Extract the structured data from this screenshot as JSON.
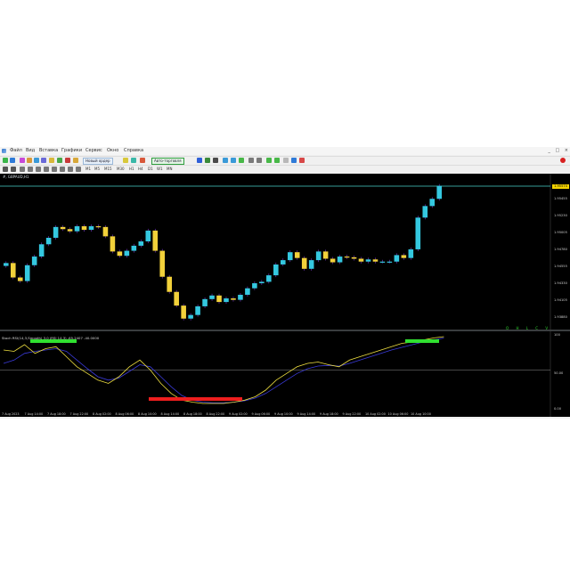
{
  "menu": {
    "items": [
      "Файл",
      "Вид",
      "Вставка",
      "Графики",
      "Сервис",
      "Окно",
      "Справка"
    ],
    "window_controls": [
      "_",
      "□",
      "×"
    ]
  },
  "toolbar": {
    "new_order_label": "Новый ордер",
    "algo_label": "Авто-торговля",
    "timeframes": [
      "M1",
      "M5",
      "M15",
      "M30",
      "H1",
      "H4",
      "D1",
      "W1",
      "MN"
    ]
  },
  "chart": {
    "title": "#, GBPAUD,H1",
    "current_price": "1.95574",
    "price_labels": [
      "1.95574",
      "1.95455",
      "1.95230",
      "1.95005",
      "1.94780",
      "1.94555",
      "1.94330",
      "1.94105",
      "1.93880"
    ],
    "ohlc": [
      "O",
      "H",
      "L",
      "C",
      "V"
    ],
    "oscillator_title": "Stoch RSI(14,3,Smooth) 3.0 (RSI 14,3) -65.2407 -40.0000",
    "osc_labels": [
      "100",
      "50.00",
      "0.00"
    ],
    "time_labels": [
      "7 Aug 2023",
      "7 Aug 14:00",
      "7 Aug 18:00",
      "7 Aug 22:00",
      "8 Aug 02:00",
      "8 Aug 06:00",
      "8 Aug 10:00",
      "8 Aug 14:00",
      "8 Aug 18:00",
      "8 Aug 22:00",
      "9 Aug 02:00",
      "9 Aug 06:00",
      "9 Aug 10:00",
      "9 Aug 14:00",
      "9 Aug 18:00",
      "9 Aug 22:00",
      "10 Aug 02:00",
      "10 Aug 06:00",
      "10 Aug 10:00"
    ],
    "colors": {
      "background": "#000000",
      "bull": "#34c8e0",
      "bear": "#f2d13a",
      "wick": "#7a3ad0",
      "oscillator_main": "#f0e040",
      "oscillator_signal": "#3a3ad8",
      "overbought_bar": "#30e030",
      "oversold_bar": "#ee1e1e",
      "price_line": "#49d2c8"
    }
  },
  "chart_data": {
    "type": "candlestick",
    "close": [
      1.9461,
      1.9441,
      1.9436,
      1.9458,
      1.947,
      1.9487,
      1.9496,
      1.9511,
      1.9508,
      1.9505,
      1.9512,
      1.9507,
      1.9512,
      1.9511,
      1.9498,
      1.9477,
      1.9471,
      1.9478,
      1.9485,
      1.9491,
      1.9506,
      1.9478,
      1.9442,
      1.9421,
      1.9402,
      1.9384,
      1.9389,
      1.9401,
      1.9411,
      1.9416,
      1.9407,
      1.9412,
      1.941,
      1.9417,
      1.9426,
      1.9433,
      1.9435,
      1.9444,
      1.9459,
      1.9465,
      1.9476,
      1.9468,
      1.9453,
      1.9465,
      1.9477,
      1.9467,
      1.9462,
      1.947,
      1.9469,
      1.9467,
      1.9463,
      1.9466,
      1.9463,
      1.9463,
      1.9463,
      1.9472,
      1.9468,
      1.948,
      1.9524,
      1.954,
      1.955,
      1.9568
    ],
    "oscillator_main": [
      80,
      78,
      88,
      75,
      82,
      85,
      70,
      55,
      45,
      35,
      30,
      40,
      55,
      65,
      50,
      30,
      15,
      5,
      2,
      0,
      0,
      0,
      2,
      5,
      10,
      20,
      35,
      45,
      55,
      60,
      62,
      58,
      55,
      65,
      70,
      75,
      80,
      85,
      90,
      92,
      95,
      98,
      100
    ],
    "oscillator_signal": [
      60,
      65,
      75,
      78,
      80,
      82,
      78,
      65,
      52,
      40,
      35,
      38,
      48,
      58,
      55,
      40,
      25,
      12,
      5,
      2,
      1,
      1,
      2,
      4,
      8,
      15,
      25,
      35,
      45,
      52,
      56,
      57,
      56,
      60,
      65,
      70,
      75,
      80,
      84,
      88,
      92,
      95,
      98
    ],
    "oscillator_levels": [
      50,
      0
    ],
    "osc_ylim": [
      0,
      100
    ]
  }
}
